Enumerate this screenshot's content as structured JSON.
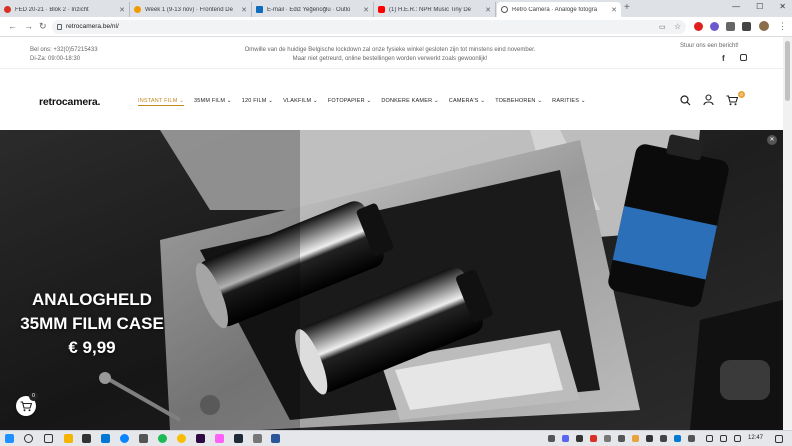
{
  "browser": {
    "tabs": [
      {
        "label": "FED 20-21 · Blok 2 · Inzicht",
        "color": "#d93025"
      },
      {
        "label": "Week 1 (9-13 nov) · Frontend De",
        "color": "#f29900"
      },
      {
        "label": "E-mail · Ediz Yeğenoğlu · Outlo",
        "color": "#0f6cbd"
      },
      {
        "label": "(1) H.E.R.: NPR Music Tiny De",
        "color": "#ff0000"
      },
      {
        "label": "Retro Camera · Analoge fotogra",
        "color": "#555555"
      }
    ],
    "url": "retrocamera.be/nl/"
  },
  "topbar": {
    "phone": "Bel ons: +32(0)57215433",
    "hours": "Di-Za: 09:00-18:30",
    "notice_line1": "Omwille van de huidige Belgische lockdown zal onze fysieke winkel gesloten zijn tot minstens eind november.",
    "notice_line2": "Maar niet getreurd, online bestellingen worden verwerkt zoals gewoonlijk!",
    "message_us": "Stuur ons een bericht!"
  },
  "header": {
    "logo": "retrocamera.",
    "menu": [
      "INSTANT FILM",
      "35MM FILM",
      "120 FILM",
      "VLAKFILM",
      "FOTOPAPIER",
      "DONKERE KAMER",
      "CAMERA'S",
      "TOEBEHOREN",
      "RARITIES"
    ],
    "cart_count": "0"
  },
  "hero": {
    "line1": "ANALOGHELD",
    "line2": "35MM FILM CASE",
    "price": "€ 9,99"
  },
  "float_cart_count": "0",
  "taskbar": {
    "time": "12:47"
  },
  "colors": {
    "accent": "#c28a1e",
    "badge": "#e8a33d"
  }
}
